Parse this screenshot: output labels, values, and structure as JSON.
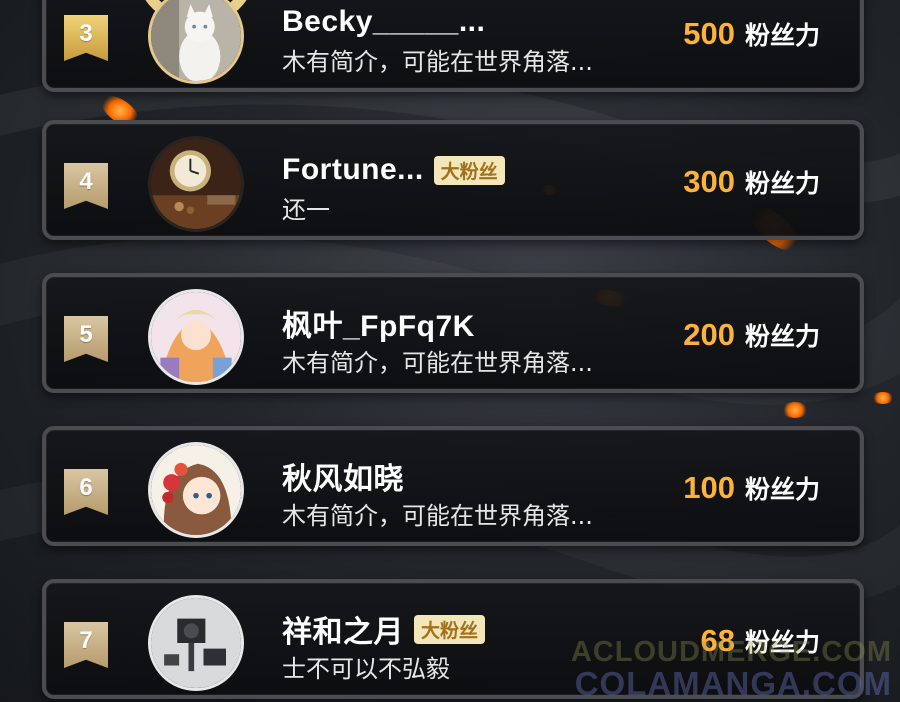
{
  "rows": [
    {
      "rank": "3",
      "name": "Becky_____...",
      "badge": "",
      "bio": "木有简介，可能在世界角落...",
      "score": "500",
      "unit": "粉丝力",
      "avatar": "white-cat-avatar"
    },
    {
      "rank": "4",
      "name": "Fortune...",
      "badge": "大粉丝",
      "bio": "还一",
      "score": "300",
      "unit": "粉丝力",
      "avatar": "clock-avatar"
    },
    {
      "rank": "5",
      "name": "枫叶_FpFq7K",
      "badge": "",
      "bio": "木有简介，可能在世界角落...",
      "score": "200",
      "unit": "粉丝力",
      "avatar": "anime-couple-avatar"
    },
    {
      "rank": "6",
      "name": "秋风如晓",
      "badge": "",
      "bio": "木有简介，可能在世界角落...",
      "score": "100",
      "unit": "粉丝力",
      "avatar": "anime-girl-flowers-avatar"
    },
    {
      "rank": "7",
      "name": "祥和之月",
      "badge": "大粉丝",
      "bio": "士不可以不弘毅",
      "score": "68",
      "unit": "粉丝力",
      "avatar": "camera-gear-avatar"
    }
  ],
  "watermark": {
    "line1": "ACLOUDMERGE.COM",
    "line2": "COLAMANGA.COM"
  },
  "colors": {
    "score": "#ffb23a",
    "badge_bg": "#f3e6b8",
    "badge_text": "#a2701e",
    "ribbon": "#c9b285"
  }
}
